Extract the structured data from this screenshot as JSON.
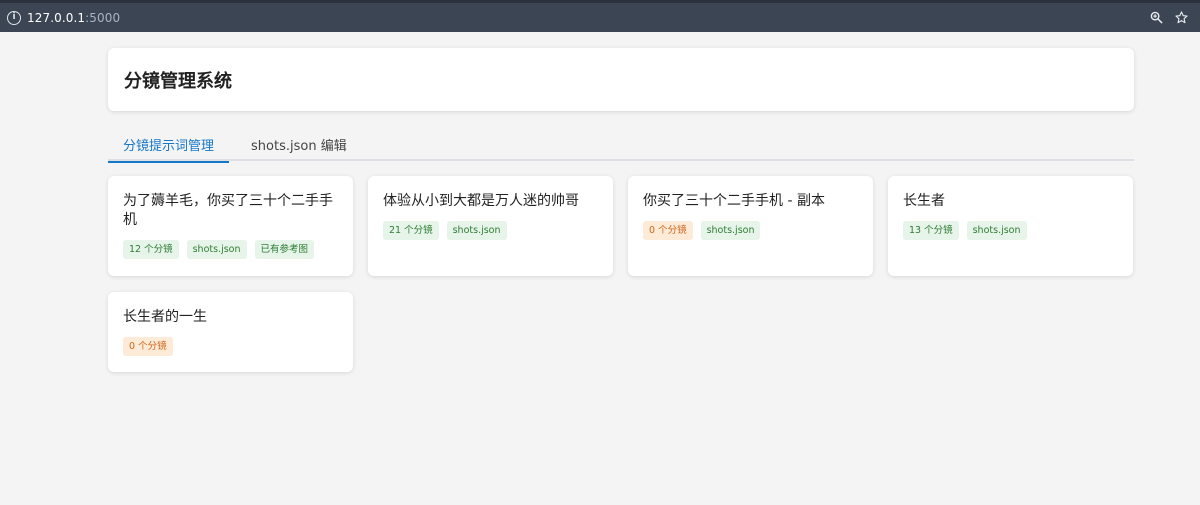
{
  "browser": {
    "url_host": "127.0.0.1",
    "url_port": ":5000",
    "info_icon": "info-icon",
    "zoom_icon": "zoom-icon",
    "bookmark_icon": "star-icon"
  },
  "header": {
    "title": "分镜管理系统"
  },
  "tabs": [
    {
      "label": "分镜提示词管理",
      "active": true
    },
    {
      "label": "shots.json 编辑",
      "active": false
    }
  ],
  "projects": [
    {
      "title": "为了薅羊毛，你买了三十个二手手机",
      "tags": [
        {
          "text": "12 个分镜",
          "color": "green"
        },
        {
          "text": "shots.json",
          "color": "green"
        },
        {
          "text": "已有参考图",
          "color": "green"
        }
      ]
    },
    {
      "title": "体验从小到大都是万人迷的帅哥",
      "tags": [
        {
          "text": "21 个分镜",
          "color": "green"
        },
        {
          "text": "shots.json",
          "color": "green"
        }
      ]
    },
    {
      "title": "你买了三十个二手手机 - 副本",
      "tags": [
        {
          "text": "0 个分镜",
          "color": "orange"
        },
        {
          "text": "shots.json",
          "color": "green"
        }
      ]
    },
    {
      "title": "长生者",
      "tags": [
        {
          "text": "13 个分镜",
          "color": "green"
        },
        {
          "text": "shots.json",
          "color": "green"
        }
      ]
    },
    {
      "title": "长生者的一生",
      "tags": [
        {
          "text": "0 个分镜",
          "color": "orange"
        }
      ]
    }
  ],
  "colors": {
    "accent": "#1677c9",
    "tag_green_bg": "#e6f4ea",
    "tag_green_fg": "#2e7d32",
    "tag_orange_bg": "#fdebd8",
    "tag_orange_fg": "#d0661a"
  }
}
